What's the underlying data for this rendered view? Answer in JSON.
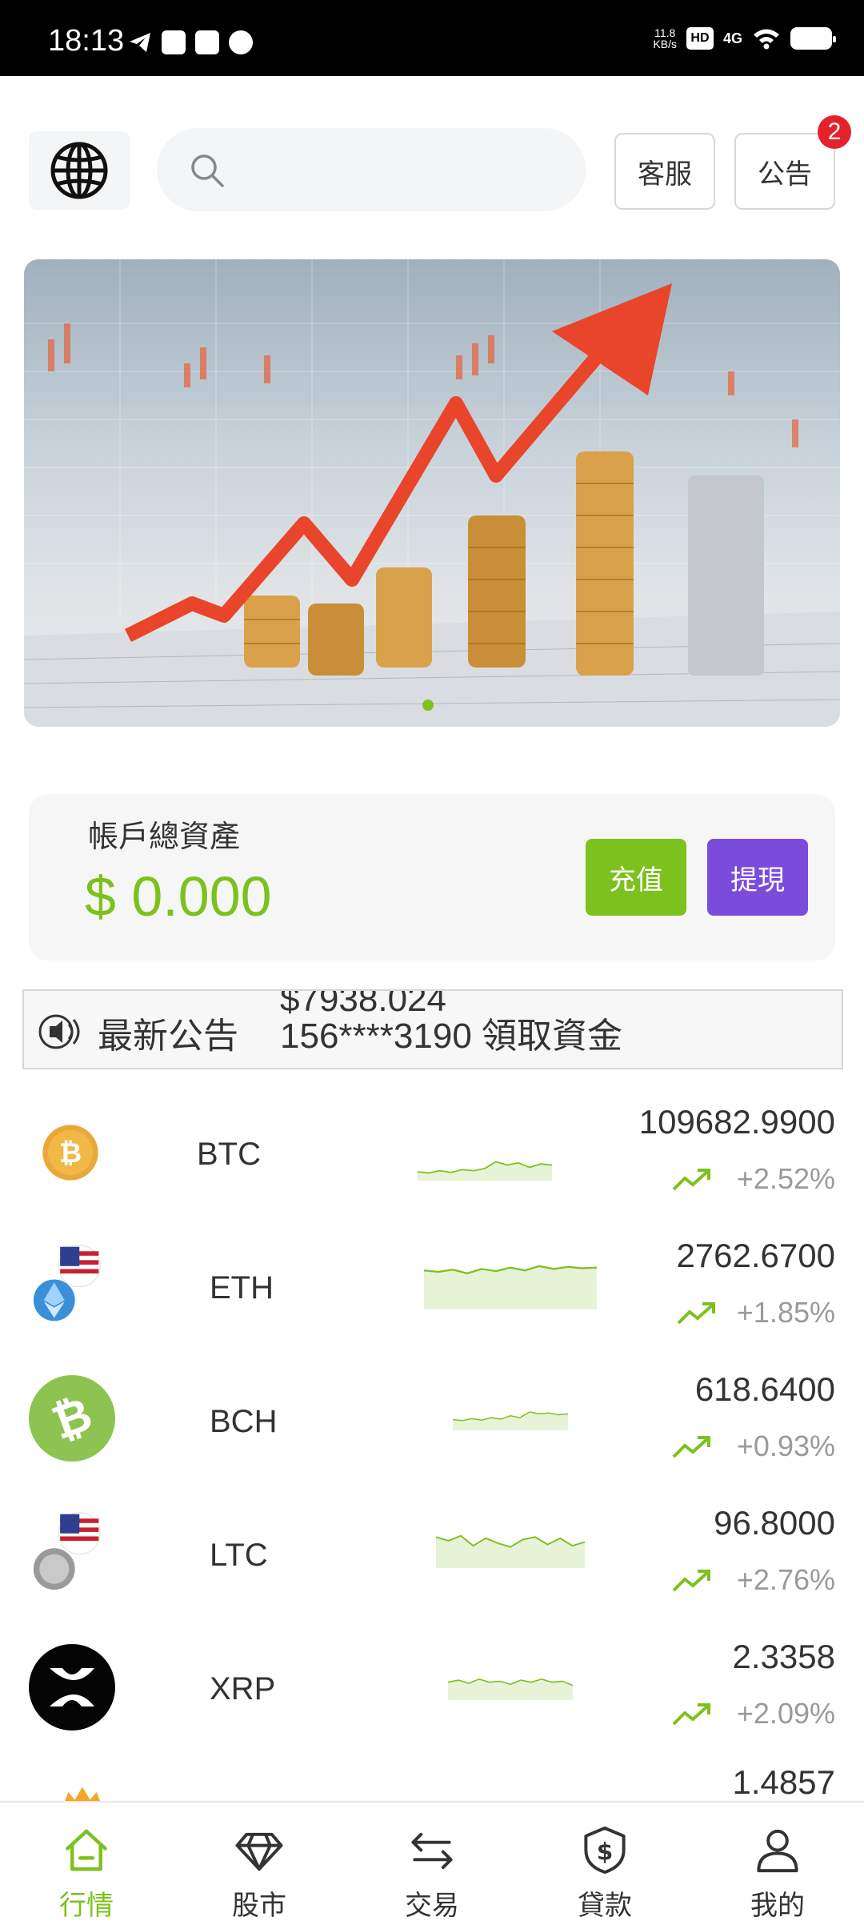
{
  "status_bar": {
    "time": "18:13",
    "speed": "11.8",
    "speed_unit": "KB/s",
    "network": "4G",
    "hd": "HD"
  },
  "header": {
    "search_placeholder": "",
    "service_label": "客服",
    "notice_label": "公告",
    "notice_badge": "2"
  },
  "assets": {
    "label": "帳戶總資產",
    "value": "$ 0.000",
    "deposit_label": "充值",
    "withdraw_label": "提現"
  },
  "announcement": {
    "label": "最新公告",
    "scroll_prev": "$7938.024",
    "text": "156****3190 領取資金"
  },
  "market": {
    "accent_color": "#7cc11d",
    "items": [
      {
        "symbol": "BTC",
        "price": "109682.9900",
        "change": "+2.52%"
      },
      {
        "symbol": "ETH",
        "price": "2762.6700",
        "change": "+1.85%"
      },
      {
        "symbol": "BCH",
        "price": "618.6400",
        "change": "+0.93%"
      },
      {
        "symbol": "LTC",
        "price": "96.8000",
        "change": "+2.76%"
      },
      {
        "symbol": "XRP",
        "price": "2.3358",
        "change": "+2.09%"
      },
      {
        "symbol": "",
        "price": "1.4857",
        "change": ""
      }
    ]
  },
  "nav": {
    "items": [
      {
        "label": "行情",
        "icon": "home-icon",
        "active": true
      },
      {
        "label": "股市",
        "icon": "diamond-icon",
        "active": false
      },
      {
        "label": "交易",
        "icon": "swap-icon",
        "active": false
      },
      {
        "label": "貸款",
        "icon": "dollar-shield-icon",
        "active": false
      },
      {
        "label": "我的",
        "icon": "user-icon",
        "active": false
      }
    ]
  }
}
